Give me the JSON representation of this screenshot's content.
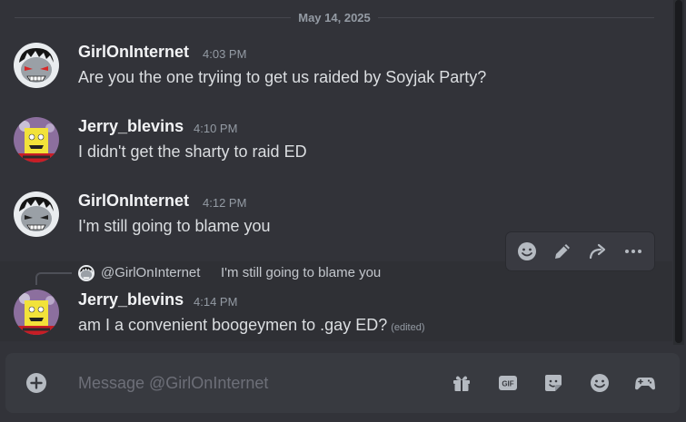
{
  "date_divider": "May 14, 2025",
  "messages": [
    {
      "username": "GirlOnInternet",
      "timestamp": "4:03 PM",
      "content": "Are you the one tryiing to get us raided by Soyjak Party?"
    },
    {
      "username": "Jerry_blevins",
      "timestamp": "4:10 PM",
      "content": "I didn't get the sharty to raid ED"
    },
    {
      "username": "GirlOnInternet",
      "timestamp": "4:12 PM",
      "content": "I'm still going to blame you"
    },
    {
      "username": "Jerry_blevins",
      "timestamp": "4:14 PM",
      "content": "am I a convenient boogeymen to .gay ED?",
      "edited": "(edited)"
    }
  ],
  "reply": {
    "mention": "@GirlOnInternet",
    "text": "I'm still going to blame you"
  },
  "toolbar": {
    "icons": [
      "add-reaction-icon",
      "edit-icon",
      "forward-icon",
      "more-options-icon"
    ]
  },
  "composer": {
    "placeholder": "Message @GirlOnInternet",
    "icons": [
      "add-attachment-icon",
      "gift-icon",
      "gif-icon",
      "sticker-icon",
      "emoji-icon",
      "activities-icon"
    ]
  },
  "colors": {
    "background": "#323339",
    "composer": "#383a40",
    "username": "#f2f3f5",
    "muted": "#949ba4"
  }
}
